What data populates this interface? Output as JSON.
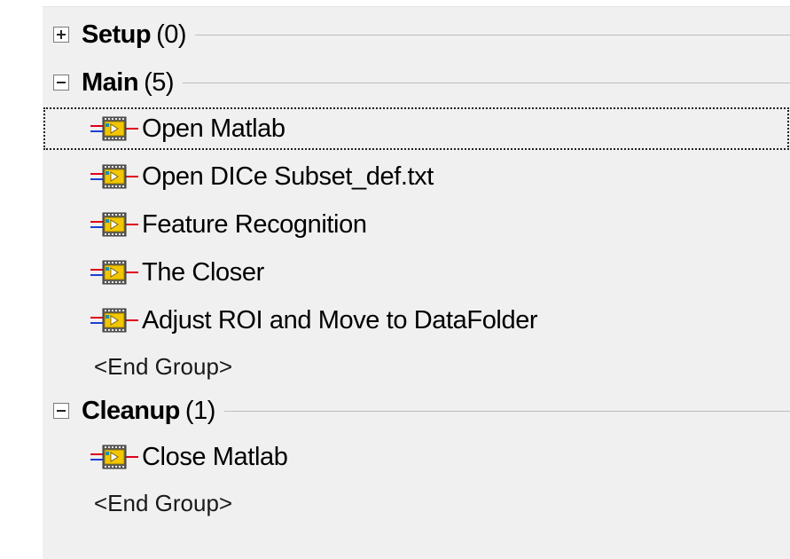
{
  "groups": [
    {
      "name": "Setup",
      "count": "(0)",
      "expanded": false
    },
    {
      "name": "Main",
      "count": "(5)",
      "expanded": true
    },
    {
      "name": "Cleanup",
      "count": "(1)",
      "expanded": true
    }
  ],
  "steps": {
    "main": [
      {
        "label": "Open Matlab",
        "icon": "vi-step-icon",
        "selected": true
      },
      {
        "label": "Open DICe Subset_def.txt",
        "icon": "vi-step-icon"
      },
      {
        "label": "Feature Recognition",
        "icon": "vi-step-icon"
      },
      {
        "label": "The Closer",
        "icon": "vi-step-icon"
      },
      {
        "label": "Adjust ROI and Move to DataFolder",
        "icon": "vi-step-icon"
      }
    ],
    "cleanup": [
      {
        "label": "Close Matlab",
        "icon": "vi-step-icon"
      }
    ]
  },
  "end_group_label": "<End Group>",
  "colors": {
    "panel_background": "#f0f0f0",
    "separator": "#bdbdbd",
    "icon_yellow": "#f2c600",
    "icon_border": "#3a3a3a",
    "wire_red": "#e0001b",
    "wire_blue": "#1a3fd8"
  }
}
